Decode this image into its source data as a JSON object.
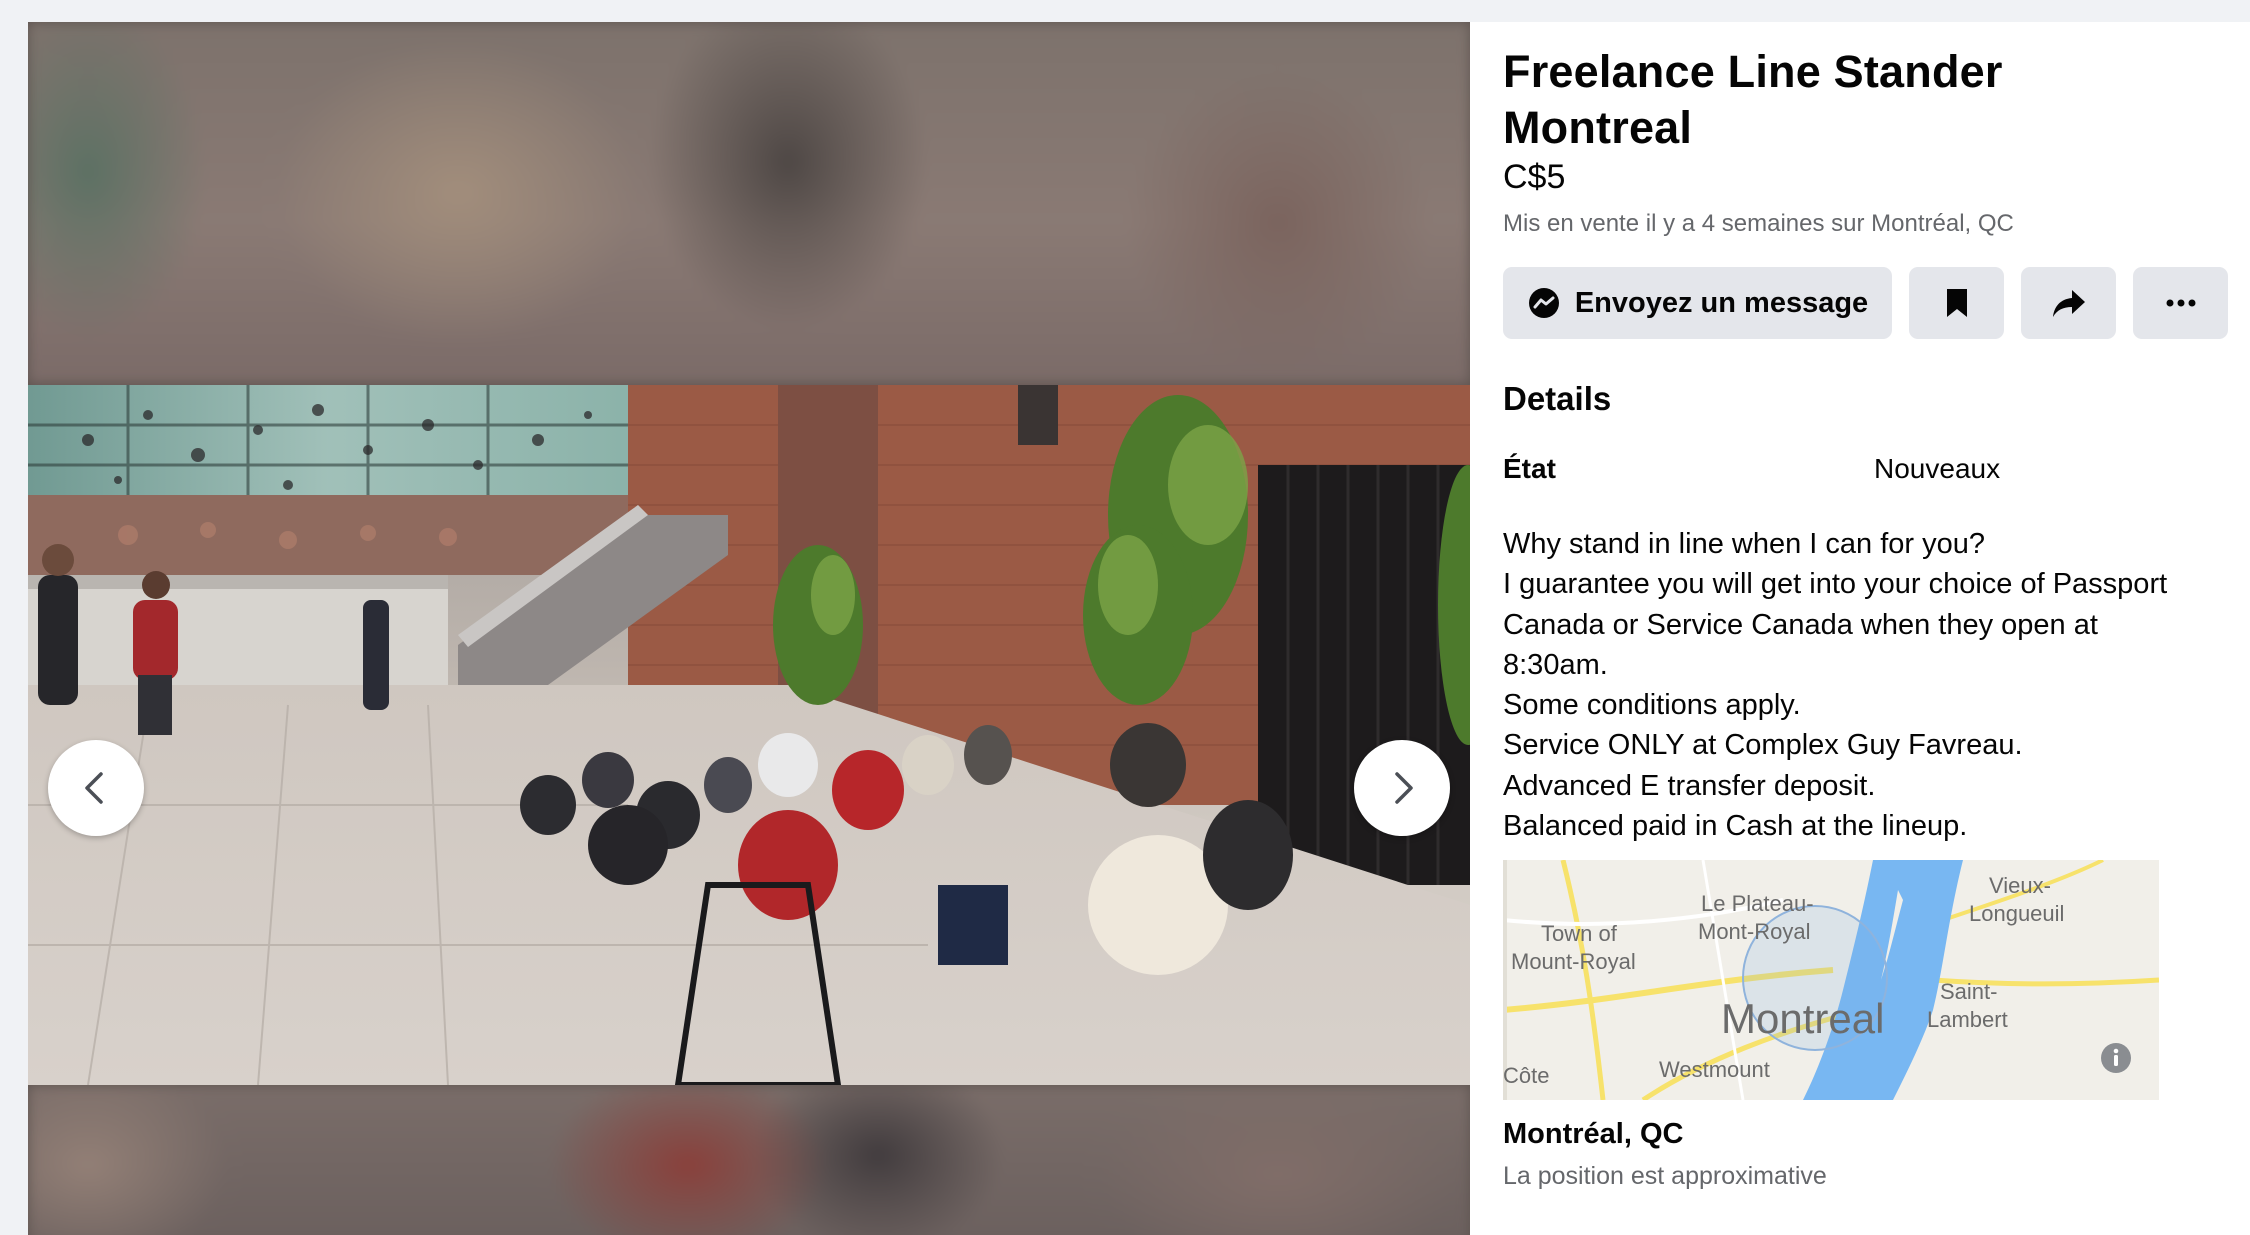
{
  "listing": {
    "title_line1": "Freelance Line Stander",
    "title_line2": "Montreal",
    "price": "C$5",
    "listed": "Mis en vente il y a 4 semaines sur Montréal, QC"
  },
  "actions": {
    "message_label": "Envoyez un message",
    "save_icon": "bookmark-icon",
    "share_icon": "share-arrow-icon",
    "more_icon": "ellipsis-icon"
  },
  "details": {
    "heading": "Details",
    "condition_label": "État",
    "condition_value": "Nouveaux",
    "description": [
      "Why stand in line when I can for you?",
      "I guarantee you will get into your choice of Passport",
      "Canada or Service Canada when they open at",
      "8:30am.",
      "Some conditions apply.",
      "Service ONLY at Complex Guy Favreau.",
      "Advanced E transfer deposit.",
      "Balanced paid in Cash at the lineup."
    ]
  },
  "map": {
    "labels": {
      "town_of": "Town of",
      "mount_royal": "Mount-Royal",
      "plateau": "Le Plateau-",
      "mont_royal": "Mont-Royal",
      "vieux": "Vieux-",
      "longueuil": "Longueuil",
      "city": "Montreal",
      "saint": "Saint-",
      "lambert": "Lambert",
      "westmount": "Westmount",
      "cote": "Côte"
    },
    "info_icon": "info-icon"
  },
  "location": {
    "name": "Montréal, QC",
    "note": "La position est approximative"
  },
  "viewer": {
    "prev_icon": "chevron-left-icon",
    "next_icon": "chevron-right-icon"
  },
  "colors": {
    "panel_bg": "#ffffff",
    "button_bg": "#e4e6eb",
    "secondary_text": "#65676b",
    "map_water": "#78b7f2",
    "map_road": "#f7e26b"
  }
}
